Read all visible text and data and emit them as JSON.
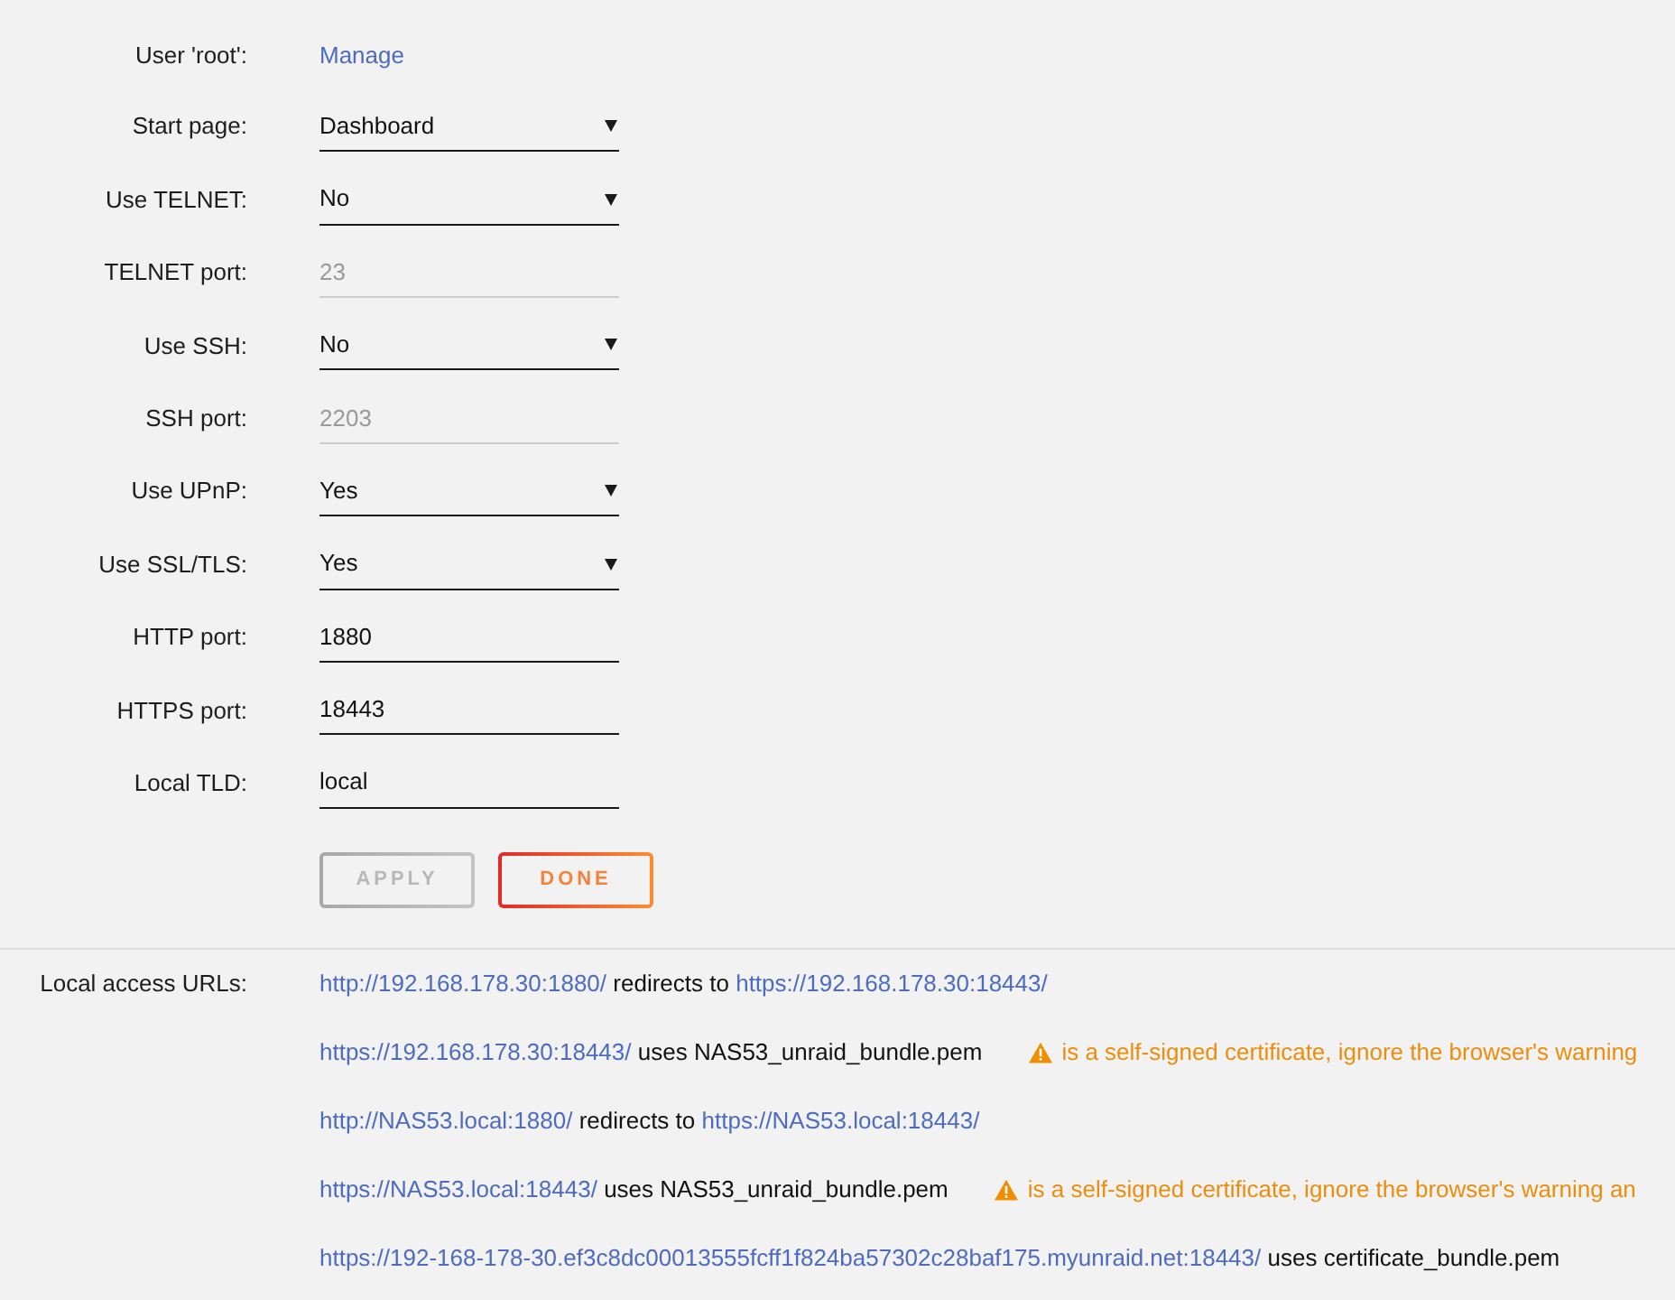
{
  "settings": [
    {
      "label": "User 'root':",
      "kind": "link",
      "value": "Manage"
    },
    {
      "label": "Start page:",
      "kind": "select",
      "value": "Dashboard",
      "disabled": false
    },
    {
      "label": "Use TELNET:",
      "kind": "select",
      "value": "No",
      "disabled": false
    },
    {
      "label": "TELNET port:",
      "kind": "input",
      "value": "23",
      "disabled": true
    },
    {
      "label": "Use SSH:",
      "kind": "select",
      "value": "No",
      "disabled": false
    },
    {
      "label": "SSH port:",
      "kind": "input",
      "value": "2203",
      "disabled": true
    },
    {
      "label": "Use UPnP:",
      "kind": "select",
      "value": "Yes",
      "disabled": false
    },
    {
      "label": "Use SSL/TLS:",
      "kind": "select",
      "value": "Yes",
      "disabled": false
    },
    {
      "label": "HTTP port:",
      "kind": "input",
      "value": "1880",
      "disabled": false
    },
    {
      "label": "HTTPS port:",
      "kind": "input",
      "value": "18443",
      "disabled": false
    },
    {
      "label": "Local TLD:",
      "kind": "input",
      "value": "local",
      "disabled": false
    }
  ],
  "buttons": [
    {
      "label": "APPLY",
      "disabled": true
    },
    {
      "label": "DONE",
      "disabled": false
    }
  ],
  "local_access": {
    "label": "Local access URLs:",
    "rows": [
      {
        "parts": [
          {
            "kind": "link",
            "text": "http://192.168.178.30:1880/"
          },
          {
            "kind": "text",
            "text": "redirects to"
          },
          {
            "kind": "link",
            "text": "https://192.168.178.30:18443/"
          }
        ]
      },
      {
        "parts": [
          {
            "kind": "link",
            "text": "https://192.168.178.30:18443/"
          },
          {
            "kind": "text",
            "text": "uses NAS53_unraid_bundle.pem"
          }
        ],
        "warning": "is a self-signed certificate, ignore the browser's warning"
      },
      {
        "parts": [
          {
            "kind": "link",
            "text": "http://NAS53.local:1880/"
          },
          {
            "kind": "text",
            "text": "redirects to"
          },
          {
            "kind": "link",
            "text": "https://NAS53.local:18443/"
          }
        ]
      },
      {
        "parts": [
          {
            "kind": "link",
            "text": "https://NAS53.local:18443/"
          },
          {
            "kind": "text",
            "text": "uses NAS53_unraid_bundle.pem"
          }
        ],
        "warning": "is a self-signed certificate, ignore the browser's warning an"
      },
      {
        "parts": [
          {
            "kind": "link",
            "text": "https://192-168-178-30.ef3c8dc00013555fcff1f824ba57302c28baf175.myunraid.net:18443/"
          },
          {
            "kind": "text",
            "text": "uses certificate_bundle.pem"
          }
        ]
      }
    ]
  }
}
